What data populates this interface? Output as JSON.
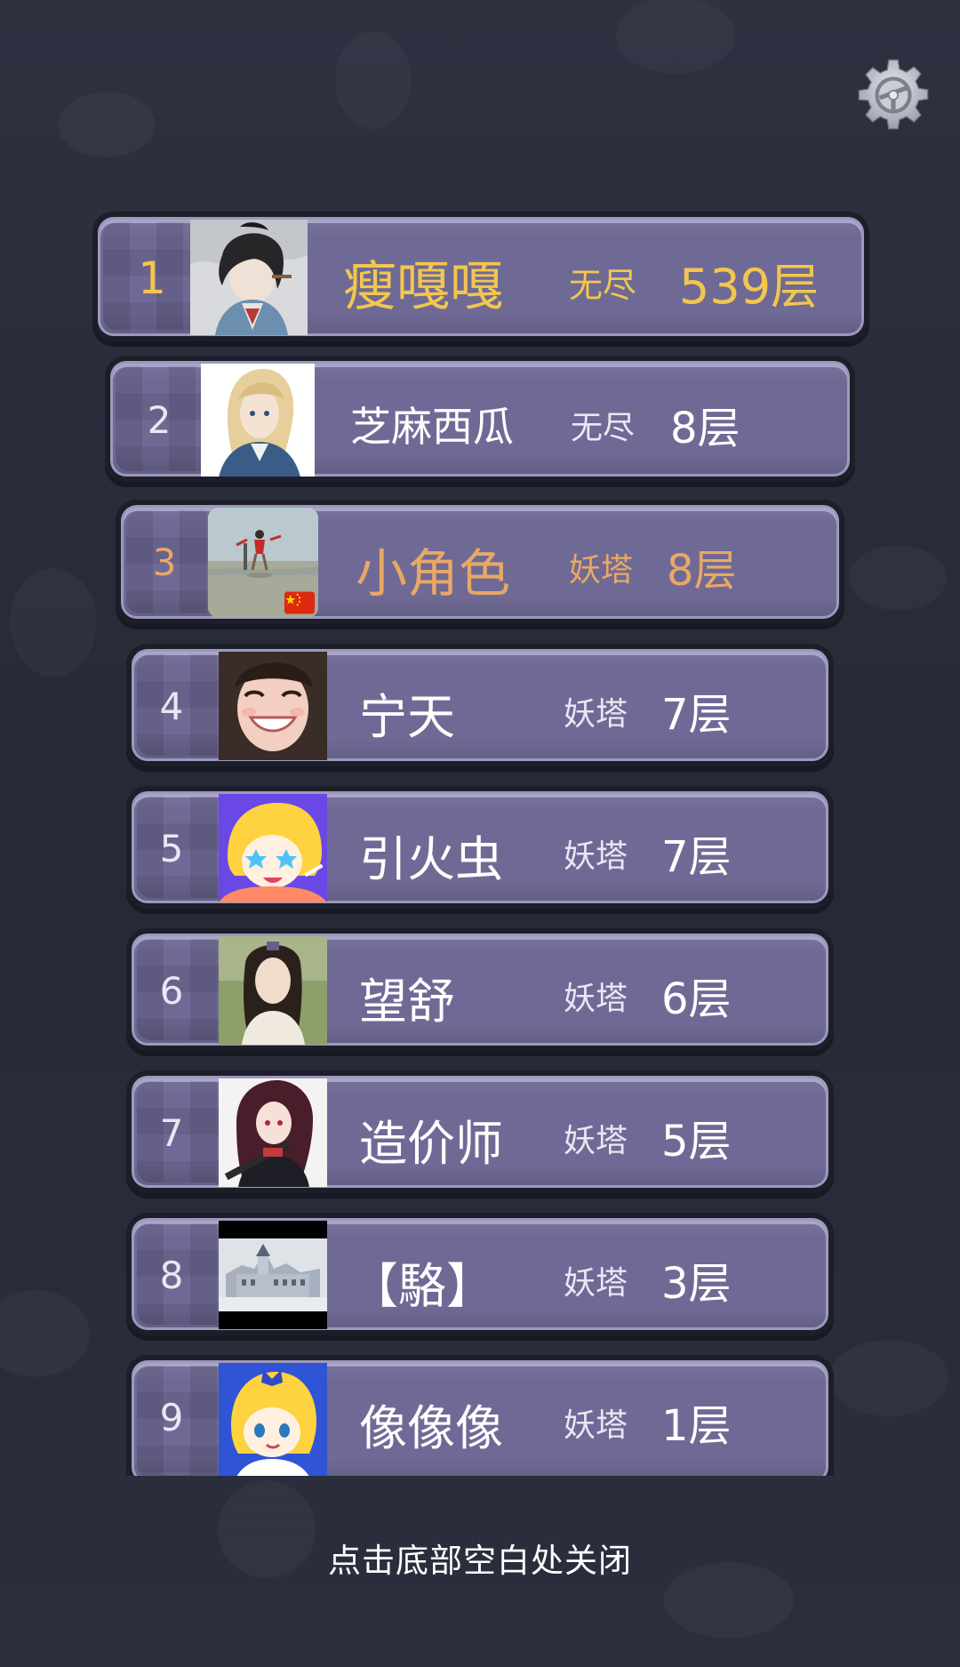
{
  "settings": {
    "icon": "gear-icon"
  },
  "leaderboard": [
    {
      "rank": "1",
      "name": "瘦嘎嘎",
      "mode": "无尽",
      "floor": "539层",
      "avatar": "avatar-ink-painting-woman",
      "rank_color": "#f3c64d",
      "name_color": "#f3c64d",
      "mode_color": "#f3c64d",
      "floor_color": "#f3c64d"
    },
    {
      "rank": "2",
      "name": "芝麻西瓜",
      "mode": "无尽",
      "floor": "8层",
      "avatar": "avatar-blonde-anime-girl",
      "rank_color": "#ece9f5",
      "name_color": "#ffffff",
      "mode_color": "#ece9f5",
      "floor_color": "#ffffff"
    },
    {
      "rank": "3",
      "name": "小角色",
      "mode": "妖塔",
      "floor": "8层",
      "avatar": "avatar-beach-photo",
      "rank_color": "#e8a866",
      "name_color": "#e8a866",
      "mode_color": "#e8a866",
      "floor_color": "#e8a866",
      "flag": "china-flag"
    },
    {
      "rank": "4",
      "name": "宁天",
      "mode": "妖塔",
      "floor": "7层",
      "avatar": "avatar-smiling-girl",
      "rank_color": "#ece9f5",
      "name_color": "#ffffff",
      "mode_color": "#ece9f5",
      "floor_color": "#ffffff"
    },
    {
      "rank": "5",
      "name": "引火虫",
      "mode": "妖塔",
      "floor": "7层",
      "avatar": "avatar-cartoon-girl-purple",
      "rank_color": "#ece9f5",
      "name_color": "#ffffff",
      "mode_color": "#ece9f5",
      "floor_color": "#ffffff"
    },
    {
      "rank": "6",
      "name": "望舒",
      "mode": "妖塔",
      "floor": "6层",
      "avatar": "avatar-long-hair-man",
      "rank_color": "#ece9f5",
      "name_color": "#ffffff",
      "mode_color": "#ece9f5",
      "floor_color": "#ffffff"
    },
    {
      "rank": "7",
      "name": "造价师",
      "mode": "妖塔",
      "floor": "5层",
      "avatar": "avatar-anime-girl-gun",
      "rank_color": "#ece9f5",
      "name_color": "#ffffff",
      "mode_color": "#ece9f5",
      "floor_color": "#ffffff"
    },
    {
      "rank": "8",
      "name": "【駱】",
      "mode": "妖塔",
      "floor": "3层",
      "avatar": "avatar-castle",
      "rank_color": "#ece9f5",
      "name_color": "#ffffff",
      "mode_color": "#ece9f5",
      "floor_color": "#ffffff"
    },
    {
      "rank": "9",
      "name": "像像像",
      "mode": "妖塔",
      "floor": "1层",
      "avatar": "avatar-cartoon-girl-blue",
      "rank_color": "#ece9f5",
      "name_color": "#ffffff",
      "mode_color": "#ece9f5",
      "floor_color": "#ffffff"
    }
  ],
  "footer": {
    "close_hint": "点击底部空白处关闭"
  }
}
